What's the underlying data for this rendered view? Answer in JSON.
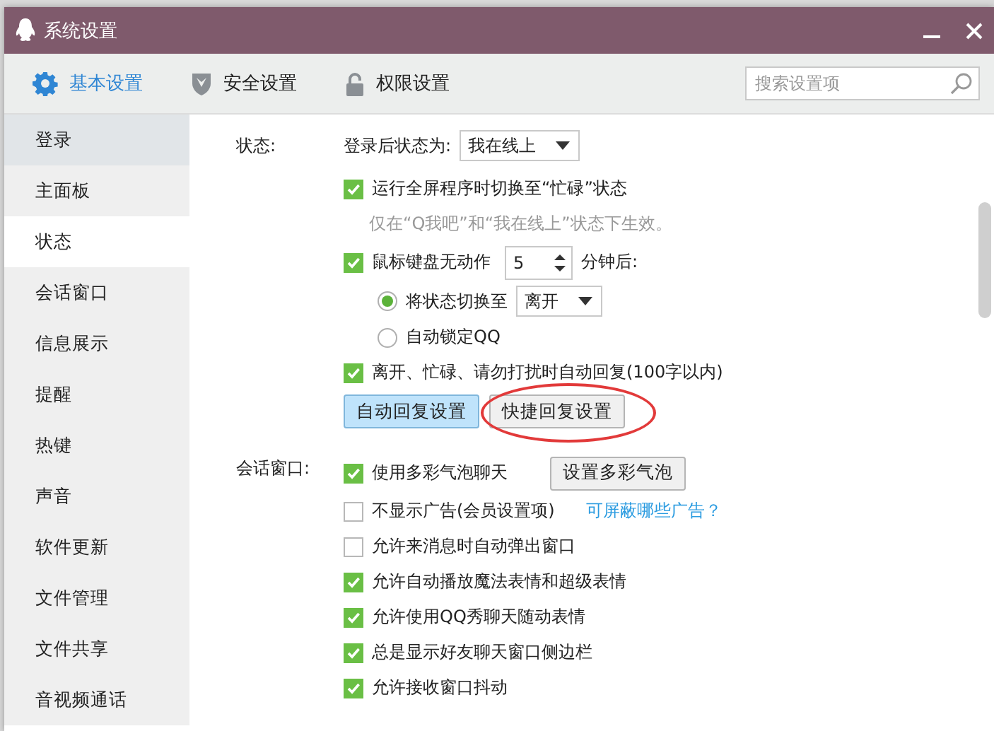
{
  "window": {
    "title": "系统设置"
  },
  "tabs": [
    {
      "label": "基本设置",
      "selected": true,
      "kind": "gear"
    },
    {
      "label": "安全设置",
      "selected": false,
      "kind": "shield"
    },
    {
      "label": "权限设置",
      "selected": false,
      "kind": "lock"
    }
  ],
  "search": {
    "placeholder": "搜索设置项"
  },
  "sidebar": {
    "items": [
      {
        "label": "登录",
        "selected": false,
        "hovered": true
      },
      {
        "label": "主面板",
        "selected": false,
        "hovered": false
      },
      {
        "label": "状态",
        "selected": true,
        "hovered": false
      },
      {
        "label": "会话窗口",
        "selected": false,
        "hovered": false
      },
      {
        "label": "信息展示",
        "selected": false,
        "hovered": false
      },
      {
        "label": "提醒",
        "selected": false,
        "hovered": false
      },
      {
        "label": "热键",
        "selected": false,
        "hovered": false
      },
      {
        "label": "声音",
        "selected": false,
        "hovered": false
      },
      {
        "label": "软件更新",
        "selected": false,
        "hovered": false
      },
      {
        "label": "文件管理",
        "selected": false,
        "hovered": false
      },
      {
        "label": "文件共享",
        "selected": false,
        "hovered": false
      },
      {
        "label": "音视频通话",
        "selected": false,
        "hovered": false
      }
    ]
  },
  "sections": [
    {
      "label": "状态:",
      "rows": [
        {
          "kind": "select",
          "label": "登录后状态为:",
          "value": "我在线上"
        },
        {
          "kind": "checkbox",
          "label": "运行全屏程序时切换至“忙碌”状态",
          "checked": true
        },
        {
          "kind": "hint",
          "text": "仅在“Q我吧”和“我在线上”状态下生效。"
        },
        {
          "kind": "spinner",
          "label": "鼠标键盘无动作",
          "checked": true,
          "value": "5",
          "suffix": "分钟后:"
        },
        {
          "kind": "radio",
          "label": "将状态切换至",
          "selected": true,
          "value": "离开"
        },
        {
          "kind": "radio",
          "label": "自动锁定QQ",
          "selected": false
        },
        {
          "kind": "checkbox",
          "label": "离开、忙碌、请勿打扰时自动回复(100字以内)",
          "checked": true
        },
        {
          "kind": "buttons",
          "buttons": [
            {
              "label": "自动回复设置",
              "pressed": true,
              "circled": false
            },
            {
              "label": "快捷回复设置",
              "pressed": false,
              "circled": true
            }
          ]
        }
      ]
    },
    {
      "label": "会话窗口:",
      "rows": [
        {
          "kind": "checkbox",
          "label": "使用多彩气泡聊天",
          "checked": true,
          "button": "设置多彩气泡"
        },
        {
          "kind": "checkbox",
          "label": "不显示广告(会员设置项)",
          "checked": false,
          "link": "可屏蔽哪些广告？"
        },
        {
          "kind": "checkbox",
          "label": "允许来消息时自动弹出窗口",
          "checked": false
        },
        {
          "kind": "checkbox",
          "label": "允许自动播放魔法表情和超级表情",
          "checked": true
        },
        {
          "kind": "checkbox",
          "label": "允许使用QQ秀聊天随动表情",
          "checked": true
        },
        {
          "kind": "checkbox",
          "label": "总是显示好友聊天窗口侧边栏",
          "checked": true
        },
        {
          "kind": "checkbox",
          "label": "允许接收窗口抖动",
          "checked": true
        }
      ]
    }
  ]
}
